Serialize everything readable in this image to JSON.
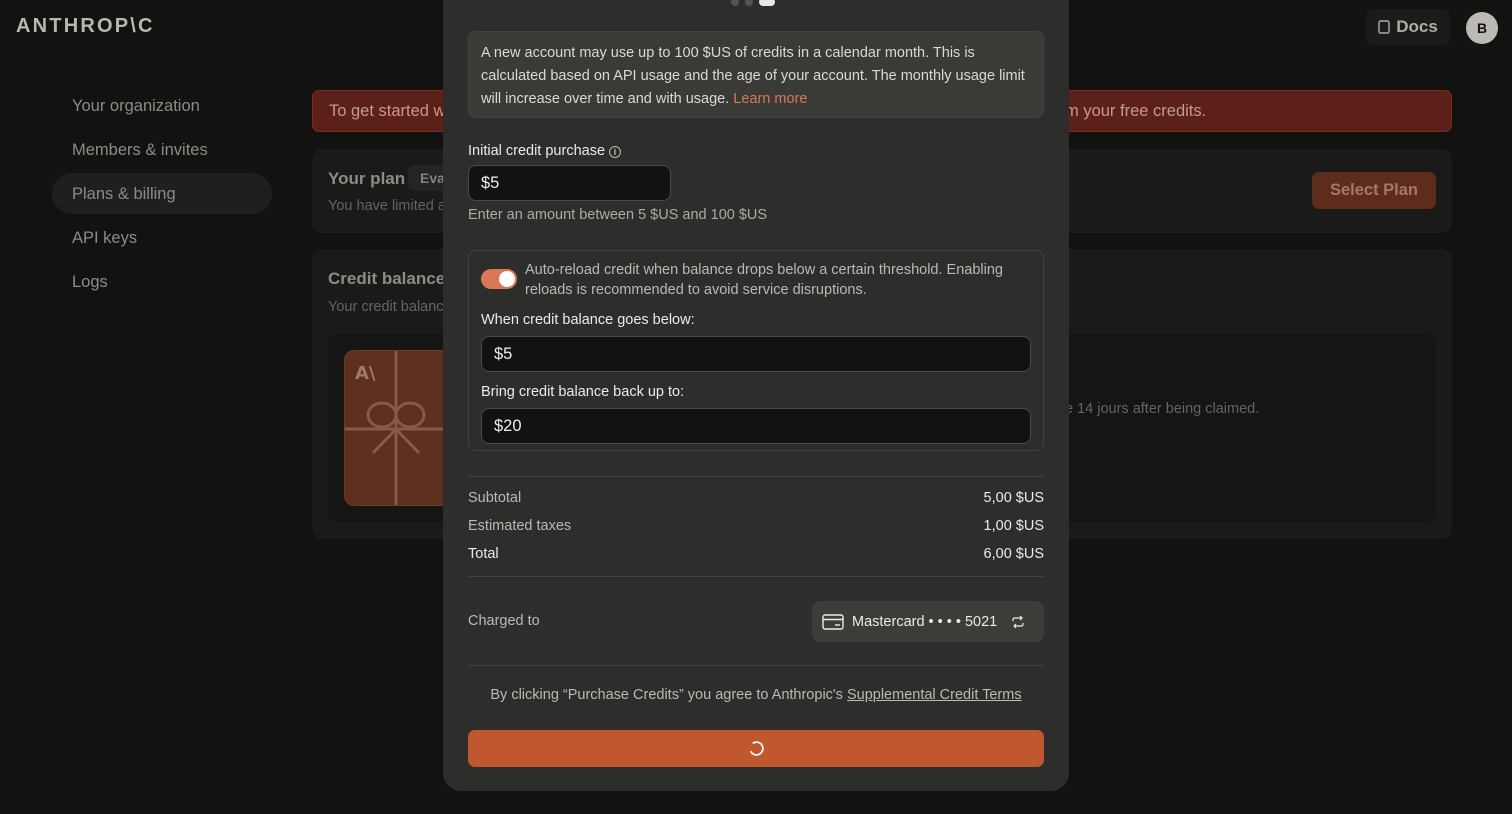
{
  "header": {
    "logo": "ANTHROP\\C",
    "docs_label": "Docs",
    "avatar_initial": "B"
  },
  "sidebar": {
    "items": [
      {
        "label": "Your organization"
      },
      {
        "label": "Members & invites"
      },
      {
        "label": "Plans & billing",
        "active": true
      },
      {
        "label": "API keys"
      },
      {
        "label": "Logs"
      }
    ]
  },
  "background": {
    "banner_left": "To get started w",
    "banner_right": "m your free credits.",
    "plan_title": "Your plan",
    "plan_badge": "Eva",
    "plan_sub": "You have limited a",
    "select_plan_label": "Select Plan",
    "credit_title": "Credit balance",
    "credit_sub": "Your credit balanc",
    "gift_logo": "A\\",
    "credit_note": "e 14 jours after being claimed."
  },
  "modal": {
    "info_text": "A new account may use up to 100 $US of credits in a calendar month. This is calculated based on API usage and the age of your account. The monthly usage limit will increase over time and with usage. ",
    "info_link": "Learn more",
    "initial_label": "Initial credit purchase",
    "initial_value": "$5",
    "initial_hint": "Enter an amount between 5 $US and 100 $US",
    "auto_reload_enabled": true,
    "auto_reload_text": "Auto-reload credit when balance drops below a certain threshold. Enabling reloads is recommended to avoid service disruptions.",
    "threshold_label": "When credit balance goes below:",
    "threshold_value": "$5",
    "reload_label": "Bring credit balance back up to:",
    "reload_value": "$20",
    "subtotal_label": "Subtotal",
    "subtotal_value": "5,00 $US",
    "taxes_label": "Estimated taxes",
    "taxes_value": "1,00 $US",
    "total_label": "Total",
    "total_value": "6,00 $US",
    "charged_label": "Charged to",
    "card_label": "Mastercard • • • • 5021",
    "terms_prefix": "By clicking “Purchase Credits” you agree to Anthropic's ",
    "terms_link": "Supplemental Credit Terms"
  },
  "colors": {
    "accent": "#d97757",
    "button": "#c0582f",
    "modal_bg": "#2d2d2b",
    "page_bg": "#121211"
  }
}
